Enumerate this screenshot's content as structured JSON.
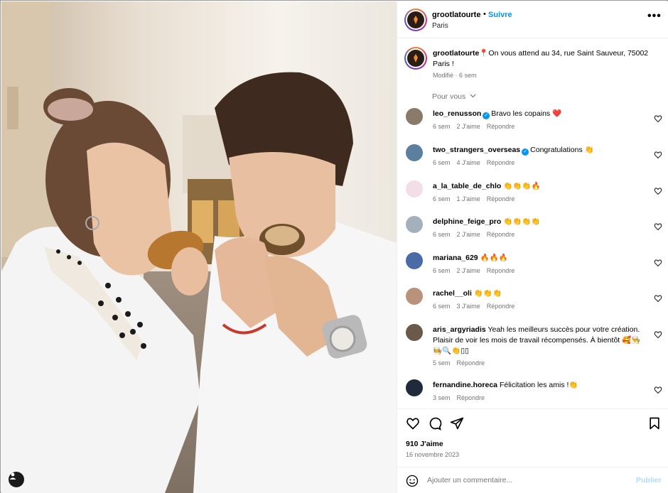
{
  "post": {
    "author": "grootlatourte",
    "follow_label": "Suivre",
    "dot": "•",
    "location": "Paris",
    "more_label": "•••",
    "caption": {
      "user": "grootlatourte",
      "pin": "📍",
      "text": "On vous attend au 34, rue Saint Sauveur, 75002 Paris !",
      "meta": "Modifié · 6 sem"
    },
    "pour_vous": "Pour vous"
  },
  "comments": [
    {
      "user": "leo_renusson",
      "verified": true,
      "text": "Bravo les copains ❤️",
      "time": "6 sem",
      "likes": "2 J'aime",
      "reply": "Répondre",
      "avatar_color": "#8a7a6a"
    },
    {
      "user": "two_strangers_overseas",
      "verified": true,
      "text": "Congratulations 👏",
      "time": "6 sem",
      "likes": "4 J'aime",
      "reply": "Répondre",
      "avatar_color": "#5c7fa0"
    },
    {
      "user": "a_la_table_de_chlo",
      "verified": false,
      "text": "👏👏👏🔥",
      "time": "6 sem",
      "likes": "1 J'aime",
      "reply": "Répondre",
      "avatar_color": "#f3dde6"
    },
    {
      "user": "delphine_feige_pro",
      "verified": false,
      "text": "👏👏👏👏",
      "time": "6 sem",
      "likes": "2 J'aime",
      "reply": "Répondre",
      "avatar_color": "#a5b0bd"
    },
    {
      "user": "mariana_629",
      "verified": false,
      "text": "🔥🔥🔥",
      "time": "6 sem",
      "likes": "2 J'aime",
      "reply": "Répondre",
      "avatar_color": "#4a6aa8"
    },
    {
      "user": "rachel__oli",
      "verified": false,
      "text": "👏👏👏",
      "time": "6 sem",
      "likes": "3 J'aime",
      "reply": "Répondre",
      "avatar_color": "#b8927a"
    },
    {
      "user": "aris_argyriadis",
      "verified": false,
      "text": "Yeah les meilleurs succès pour votre création. Plaisir de voir les mois de travail récompensés. À bientôt 🥰👨‍🍳🧑‍🍳🔍👏▯▯",
      "time": "5 sem",
      "likes": "",
      "reply": "Répondre",
      "avatar_color": "#6b5a4c"
    },
    {
      "user": "fernandine.horeca",
      "verified": false,
      "text": "Félicitation les amis !👏",
      "time": "3 sem",
      "likes": "",
      "reply": "Répondre",
      "avatar_color": "#1f2a3a"
    }
  ],
  "actions": {
    "likes": "910 J'aime",
    "date": "16 novembre 2023"
  },
  "add_comment": {
    "placeholder": "Ajouter un commentaire...",
    "publish": "Publier"
  },
  "colors": {
    "accent": "#0095f6",
    "muted": "#737373",
    "heart": "#ed4956"
  },
  "icons": [
    "more-icon",
    "verified-icon",
    "heart-icon",
    "comment-icon",
    "share-icon",
    "bookmark-icon",
    "emoji-icon",
    "user-tag-icon",
    "chevron-down-icon"
  ]
}
